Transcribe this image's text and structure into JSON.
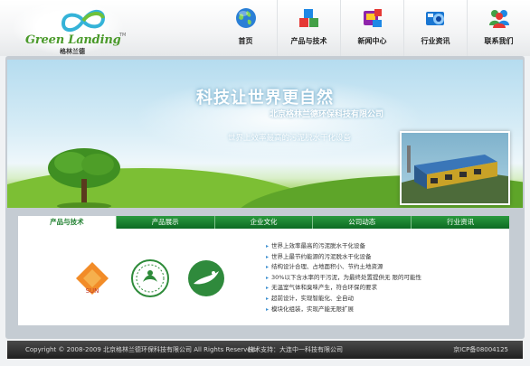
{
  "brand": {
    "name": "Green Landing",
    "name_cn": "格林兰德",
    "trademark": "TM"
  },
  "nav": [
    {
      "label": "首页",
      "icon": "globe-icon"
    },
    {
      "label": "产品与技术",
      "icon": "cubes-icon"
    },
    {
      "label": "新闻中心",
      "icon": "media-icon"
    },
    {
      "label": "行业资讯",
      "icon": "info-icon"
    },
    {
      "label": "联系我们",
      "icon": "people-icon"
    }
  ],
  "banner": {
    "title": "科技让世界更自然",
    "company": "北京格林兰德环保科技有限公司",
    "slogan": "世界上效率最高的污泥脱水干化设备"
  },
  "tabs": [
    {
      "label": "产品与技术",
      "active": true
    },
    {
      "label": "产品展示",
      "active": false
    },
    {
      "label": "企业文化",
      "active": false
    },
    {
      "label": "公司动态",
      "active": false
    },
    {
      "label": "行业资讯",
      "active": false
    }
  ],
  "certificates": [
    {
      "name": "SUN",
      "icon": "sun-logo-icon"
    },
    {
      "name": "",
      "icon": "green-seal-icon"
    },
    {
      "name": "",
      "icon": "nordic-swan-icon"
    }
  ],
  "features": [
    "世界上效率最高的污泥脱水干化设备",
    "世界上最节约能源的污泥脱水干化设备",
    "结构设计合理、占地面积小、节约土地资源",
    "30%以下含水率的干污泥，为最终处置提供无 限的可能性",
    "无温室气体和臭味产生，符合环保的要求",
    "超前设计，实现智能化、全自动",
    "模块化组装，实现产能无限扩展"
  ],
  "footer": {
    "copyright": "Copyright © 2008-2009 北京格林兰德环保科技有限公司 All Rights Reserved.",
    "support": "技术支持：大连中一科技有限公司",
    "icp": "京ICP备08004125"
  },
  "colors": {
    "accent_green": "#1e7f2e",
    "tab_green": "#0c6a22",
    "footer_dark": "#2a2a2a"
  }
}
